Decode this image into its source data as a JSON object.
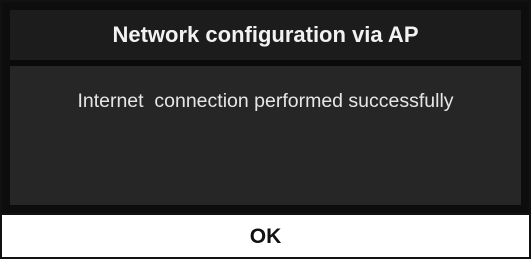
{
  "dialog": {
    "title": "Network configuration via AP",
    "message": "Internet  connection performed successfully",
    "ok_label": "OK"
  },
  "colors": {
    "dialog_background": "#262626",
    "title_text": "#f2f2f2",
    "button_background": "#ffffff"
  }
}
